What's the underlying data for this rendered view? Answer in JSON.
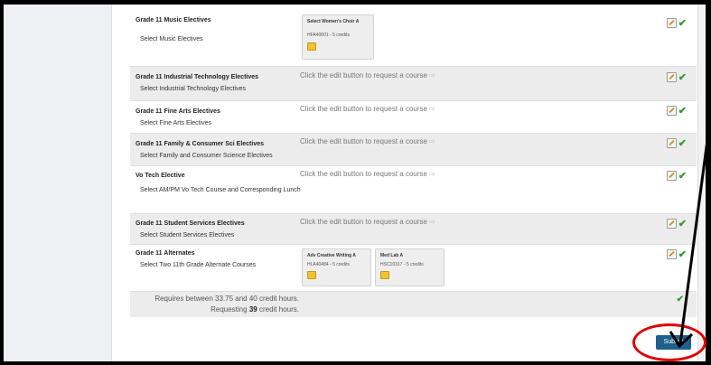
{
  "rows": [
    {
      "title": "Grade 11 Music Electives",
      "sub": "Select Music Electives",
      "courses": [
        {
          "name": "Select Women's Choir A",
          "credits": "HFA40601 - 5 credits"
        }
      ]
    },
    {
      "title": "Grade 11 Industrial Technology Electives",
      "sub": "Select Industrial Technology Electives",
      "hint": "Click the edit button to request a course"
    },
    {
      "title": "Grade 11 Fine Arts Electives",
      "sub": "Select Fine Arts Electives",
      "hint": "Click the edit button to request a course"
    },
    {
      "title": "Grade 11 Family & Consumer Sci Electives",
      "sub": "Select Family and Consumer Science Electives",
      "hint": "Click the edit button to request a course"
    },
    {
      "title": "Vo Tech Elective",
      "sub": "Select AM/PM Vo Tech Course and Corresponding Lunch",
      "hint": "Click the edit button to request a course"
    },
    {
      "title": "Grade 11 Student Services Electives",
      "sub": "Select Student Services Electives",
      "hint": "Click the edit button to request a course"
    },
    {
      "title": "Grade 11 Alternates",
      "sub": "Select Two 11th Grade Alternate Courses",
      "courses": [
        {
          "name": "Adv Creative Writing A",
          "credits": "HLA40484 - 5 credits"
        },
        {
          "name": "Med Lab A",
          "credits": "HSC10317 - 5 credits"
        }
      ]
    }
  ],
  "summary": {
    "requires": "Requires between 33.75 and 40 credit hours.",
    "requesting_prefix": "Requesting",
    "requesting_value": "39",
    "requesting_suffix": "credit hours."
  },
  "submit_label": "Submit",
  "icons": {
    "edit": "edit-pencil-icon",
    "check": "green-check-icon",
    "note": "note-icon",
    "arrow": "right-arrow-icon"
  },
  "colors": {
    "accent": "#1f5f8b",
    "check": "#2a9d33",
    "highlight": "#e00000"
  }
}
